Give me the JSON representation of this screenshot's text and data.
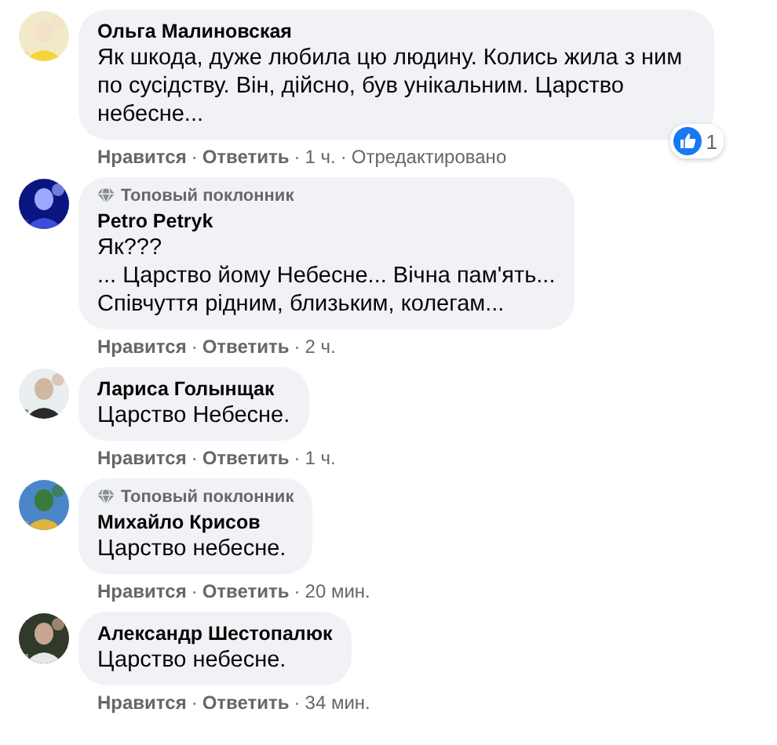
{
  "comments": [
    {
      "author": "Ольга Малиновская",
      "paragraphs": [
        "Як шкода, дуже любила цю людину. Колись жила з ним по сусідству. Він, дійсно, був унікальним. Царство небесне..."
      ],
      "reactions": {
        "count": "1"
      },
      "actions": {
        "like": "Нравится",
        "separator": "·",
        "reply": "Ответить",
        "time": "1 ч.",
        "edited": "Отредактировано"
      }
    },
    {
      "badge": "Топовый поклонник",
      "author": "Petro Petryk",
      "paragraphs": [
        "Як???",
        "... Царство йому Небесне... Вічна пам'ять...",
        "Співчуття рідним, близьким, колегам..."
      ],
      "actions": {
        "like": "Нравится",
        "separator": "·",
        "reply": "Ответить",
        "time": "2 ч."
      }
    },
    {
      "author": "Лариса Голынщак",
      "paragraphs": [
        "Царство Небесне."
      ],
      "actions": {
        "like": "Нравится",
        "separator": "·",
        "reply": "Ответить",
        "time": "1 ч."
      }
    },
    {
      "badge": "Топовый поклонник",
      "author": "Михайло Крисов",
      "paragraphs": [
        "Царство небесне."
      ],
      "actions": {
        "like": "Нравится",
        "separator": "·",
        "reply": "Ответить",
        "time": "20 мин."
      }
    },
    {
      "author": "Александр Шестопалюк",
      "paragraphs": [
        "Царство небесне."
      ],
      "actions": {
        "like": "Нравится",
        "separator": "·",
        "reply": "Ответить",
        "time": "34 мин."
      }
    }
  ]
}
